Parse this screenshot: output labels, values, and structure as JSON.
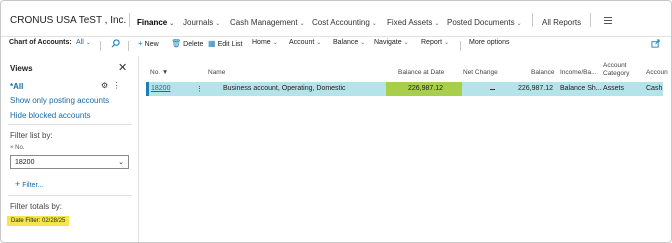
{
  "company": "CRONUS USA TeST , Inc.",
  "nav": {
    "items": [
      {
        "label": "Finance",
        "active": true
      },
      {
        "label": "Journals"
      },
      {
        "label": "Cash Management"
      },
      {
        "label": "Cost Accounting"
      },
      {
        "label": "Fixed Assets"
      },
      {
        "label": "Posted Documents"
      },
      {
        "label": "All Reports"
      }
    ],
    "menu_icon": "hamburger-icon"
  },
  "actions": {
    "page_label": "Chart of Accounts:",
    "filter_value": "All",
    "search_icon": "search-icon",
    "new": "New",
    "delete": "Delete",
    "edit_list": "Edit List",
    "home": "Home",
    "account": "Account",
    "balance": "Balance",
    "navigate": "Navigate",
    "report": "Report",
    "more": "More options",
    "share_icon": "share-icon"
  },
  "views": {
    "title": "Views",
    "all": "*All",
    "posting": "Show only posting accounts",
    "blocked": "Hide blocked accounts"
  },
  "filters": {
    "list_by": "Filter list by:",
    "field_label": "× No.",
    "field_value": "18200",
    "add": "Filter...",
    "totals_by": "Filter totals by:",
    "date_filter": "Date Filter:  02/28/25"
  },
  "table": {
    "headers": {
      "no": "No. ▼",
      "name": "Name",
      "balance_at_date": "Balance at Date",
      "net_change": "Net Change",
      "balance": "Balance",
      "income_balance": "Income/Ba...",
      "account_category_1": "Account",
      "account_category_2": "Category",
      "account_trunc": "Accoun"
    },
    "row": {
      "no": "18200",
      "menu": "⋮",
      "name": "Business account, Operating, Domestic",
      "balance_at_date": "226,987.12",
      "balance": "226,987.12",
      "income_balance": "Balance Sh...",
      "account_category": "Assets",
      "account_subcat": "Cash"
    }
  },
  "colors": {
    "accent": "#1a6aa6",
    "row_highlight": "#b4e3ea",
    "balance_highlight": "#a8cf4c",
    "date_filter_bg": "#f4e64a"
  }
}
